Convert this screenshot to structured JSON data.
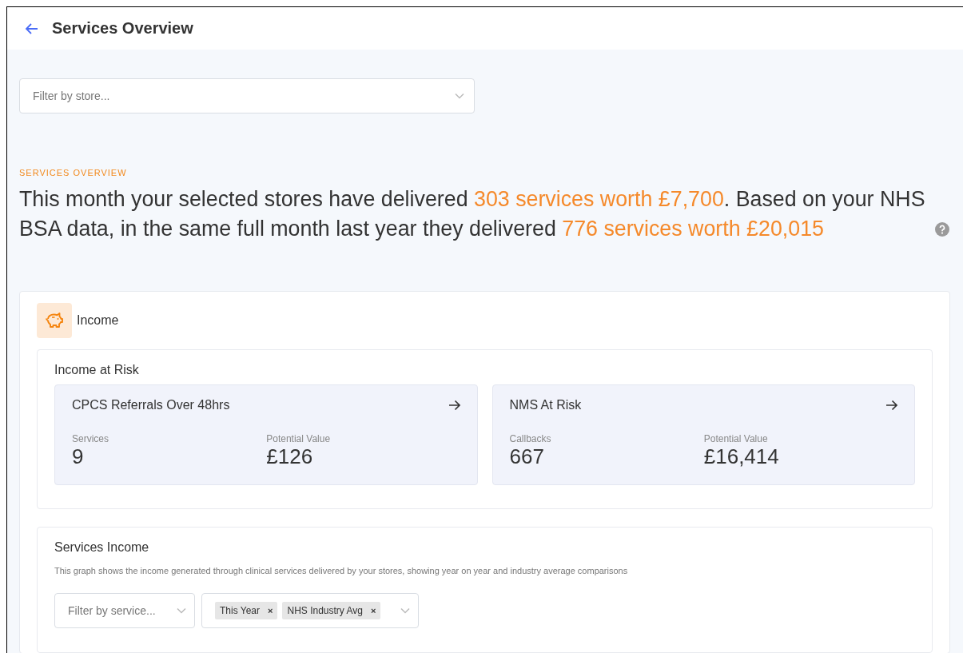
{
  "header": {
    "title": "Services Overview"
  },
  "store_filter": {
    "placeholder": "Filter by store..."
  },
  "overview": {
    "eyebrow": "SERVICES OVERVIEW",
    "summary": [
      {
        "text": "This month your selected stores have delivered ",
        "highlight": false
      },
      {
        "text": "303 services worth £7,700",
        "highlight": true
      },
      {
        "text": ". Based on your NHS BSA data, in the same full month last year they delivered ",
        "highlight": false
      },
      {
        "text": "776 services worth £20,015",
        "highlight": true
      }
    ]
  },
  "income": {
    "title": "Income",
    "income_at_risk": {
      "title": "Income at Risk",
      "cards": [
        {
          "title": "CPCS Referrals Over 48hrs",
          "metrics": [
            {
              "label": "Services",
              "value": "9"
            },
            {
              "label": "Potential Value",
              "value": "£126"
            }
          ]
        },
        {
          "title": "NMS At Risk",
          "metrics": [
            {
              "label": "Callbacks",
              "value": "667"
            },
            {
              "label": "Potential Value",
              "value": "£16,414"
            }
          ]
        }
      ]
    },
    "services_income": {
      "title": "Services Income",
      "description": "This graph shows the income generated through clinical services delivered by your stores, showing year on year and industry average comparisons",
      "service_filter": {
        "placeholder": "Filter by service..."
      },
      "series_filter": {
        "tags": [
          {
            "label": "This Year",
            "remove": "×"
          },
          {
            "label": "NHS Industry Avg",
            "remove": "×"
          }
        ]
      }
    }
  }
}
